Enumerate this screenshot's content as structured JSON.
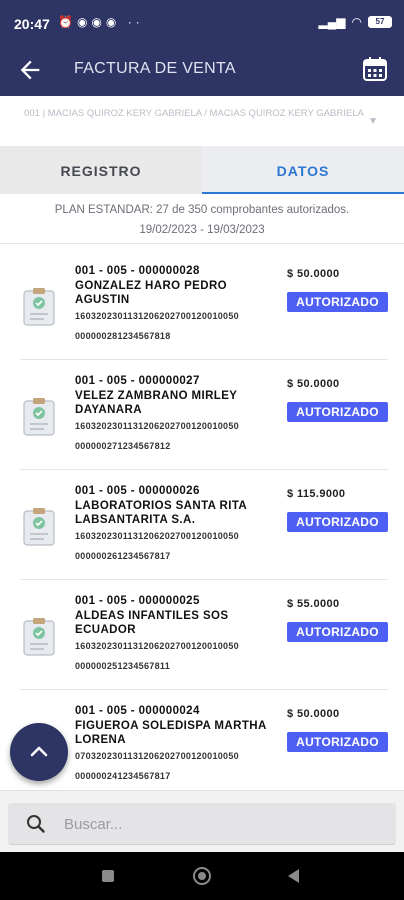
{
  "status_bar": {
    "time": "20:47",
    "battery": "57"
  },
  "app_bar": {
    "title": "FACTURA DE VENTA"
  },
  "company_selector": {
    "text": "001 | MACIAS QUIROZ KERY GABRIELA / MACIAS QUIROZ KERY GABRIELA"
  },
  "tabs": [
    {
      "label": "REGISTRO",
      "active": false
    },
    {
      "label": "DATOS",
      "active": true
    }
  ],
  "plan": {
    "line1": "PLAN ESTANDAR: 27 de 350 comprobantes autorizados.",
    "line2": "19/02/2023 - 19/03/2023"
  },
  "invoices": [
    {
      "number": "001 - 005 - 000000028",
      "client": "GONZALEZ HARO PEDRO AGUSTIN",
      "auth_line1": "1603202301131206202700120010050",
      "auth_line2": "000000281234567818",
      "amount": "$ 50.0000",
      "status": "AUTORIZADO"
    },
    {
      "number": "001 - 005 - 000000027",
      "client": "VELEZ ZAMBRANO MIRLEY DAYANARA",
      "auth_line1": "1603202301131206202700120010050",
      "auth_line2": "000000271234567812",
      "amount": "$ 50.0000",
      "status": "AUTORIZADO"
    },
    {
      "number": "001 - 005 - 000000026",
      "client": "LABORATORIOS SANTA RITA LABSANTARITA S.A.",
      "auth_line1": "1603202301131206202700120010050",
      "auth_line2": "000000261234567817",
      "amount": "$ 115.9000",
      "status": "AUTORIZADO"
    },
    {
      "number": "001 - 005 - 000000025",
      "client": "ALDEAS INFANTILES SOS ECUADOR",
      "auth_line1": "1603202301131206202700120010050",
      "auth_line2": "000000251234567811",
      "amount": "$ 55.0000",
      "status": "AUTORIZADO"
    },
    {
      "number": "001 - 005 - 000000024",
      "client": "FIGUEROA SOLEDISPA MARTHA LORENA",
      "auth_line1": "0703202301131206202700120010050",
      "auth_line2": "000000241234567817",
      "amount": "$ 50.0000",
      "status": "AUTORIZADO"
    }
  ],
  "search": {
    "placeholder": "Buscar..."
  },
  "colors": {
    "primary": "#2e3464",
    "accent": "#2d76d2",
    "badge": "#4e5ff3"
  }
}
